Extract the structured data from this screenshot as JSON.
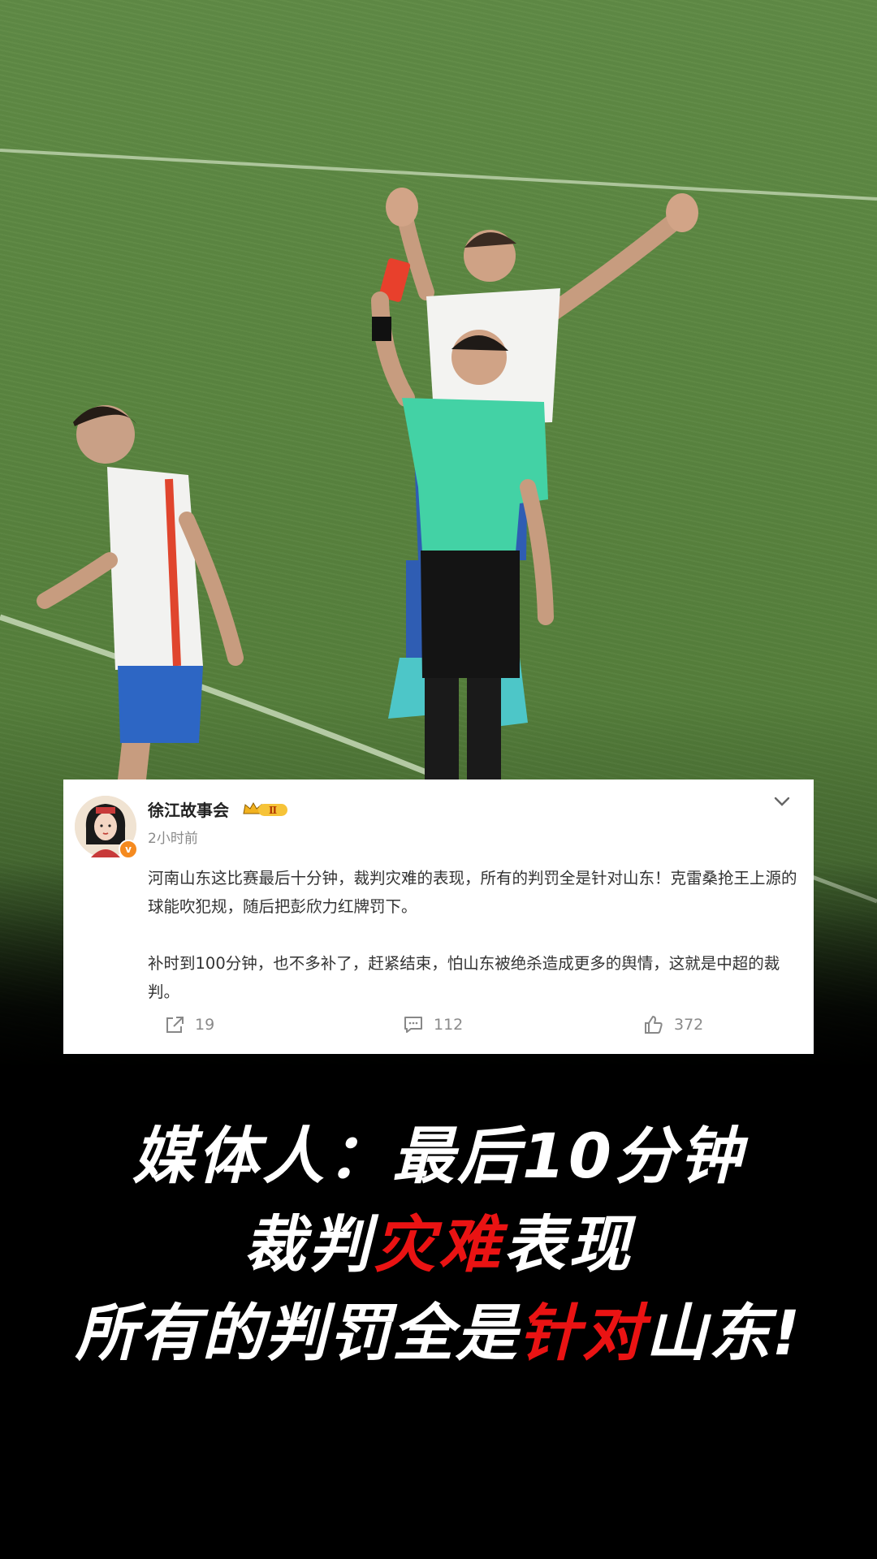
{
  "post": {
    "username": "徐江故事会",
    "time": "2小时前",
    "paragraphs": [
      "河南山东这比赛最后十分钟，裁判灾难的表现，所有的判罚全是针对山东！克雷桑抢王上源的球能吹犯规，随后把彭欣力红牌罚下。",
      "补时到100分钟，也不多补了，赶紧结束，怕山东被绝杀造成更多的舆情，这就是中超的裁判。"
    ],
    "level_badge": "Ⅱ",
    "verified_badge": "v",
    "actions": {
      "repost_count": "19",
      "comment_count": "112",
      "like_count": "372"
    },
    "icons": [
      "share-icon",
      "comment-icon",
      "like-icon",
      "chevron-down-icon",
      "crown-badge-icon"
    ]
  },
  "caption": {
    "line1": "媒体人：最后10分钟",
    "line2_prefix": "裁判",
    "line2_highlight": "灾难",
    "line2_suffix": "表现",
    "line3_prefix": "所有的判罚全是",
    "line3_highlight": "针对",
    "line3_suffix": "山东!"
  },
  "colors": {
    "highlight": "#ea1313",
    "caption_text": "#ffffff",
    "background": "#000000",
    "pitch": "#5a8540"
  }
}
